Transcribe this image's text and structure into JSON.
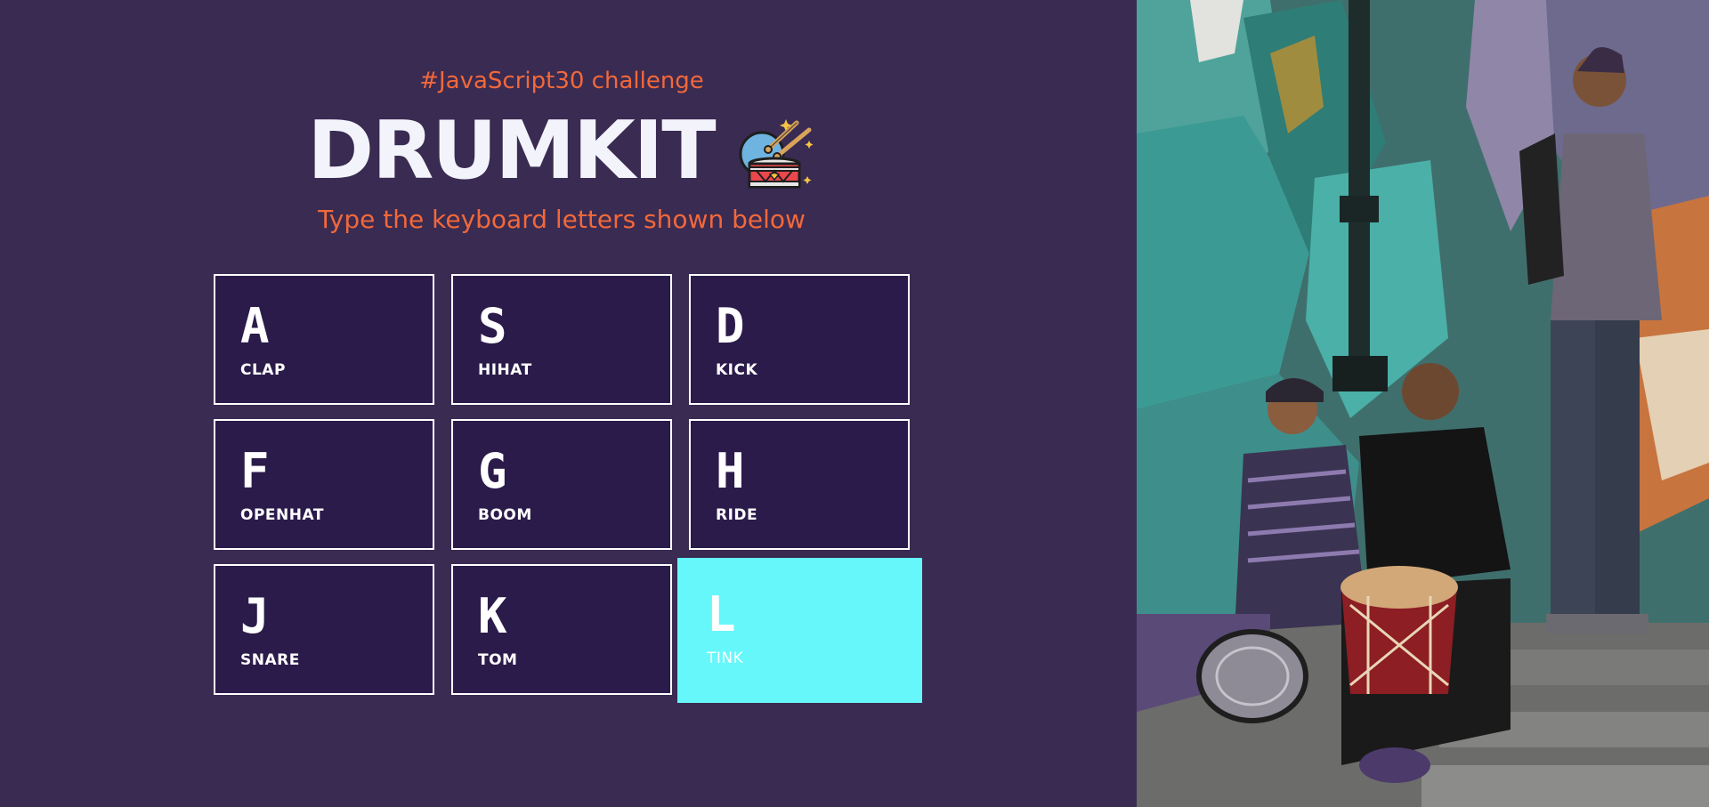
{
  "header": {
    "challenge": "#JavaScript30 challenge",
    "title": "DRUMKIT",
    "subtitle": "Type the keyboard letters shown below"
  },
  "keys": [
    {
      "letter": "A",
      "sound": "CLAP"
    },
    {
      "letter": "S",
      "sound": "HIHAT"
    },
    {
      "letter": "D",
      "sound": "KICK"
    },
    {
      "letter": "F",
      "sound": "OPENHAT"
    },
    {
      "letter": "G",
      "sound": "BOOM"
    },
    {
      "letter": "H",
      "sound": "RIDE"
    },
    {
      "letter": "J",
      "sound": "SNARE"
    },
    {
      "letter": "K",
      "sound": "TOM"
    },
    {
      "letter": "L",
      "sound": "TINK"
    }
  ],
  "colors": {
    "background": "#3a2b52",
    "key_background": "#2b1b4a",
    "accent": "#f2683a",
    "playing": "#66f7fa"
  },
  "icons": {
    "drum": "drum-icon"
  }
}
